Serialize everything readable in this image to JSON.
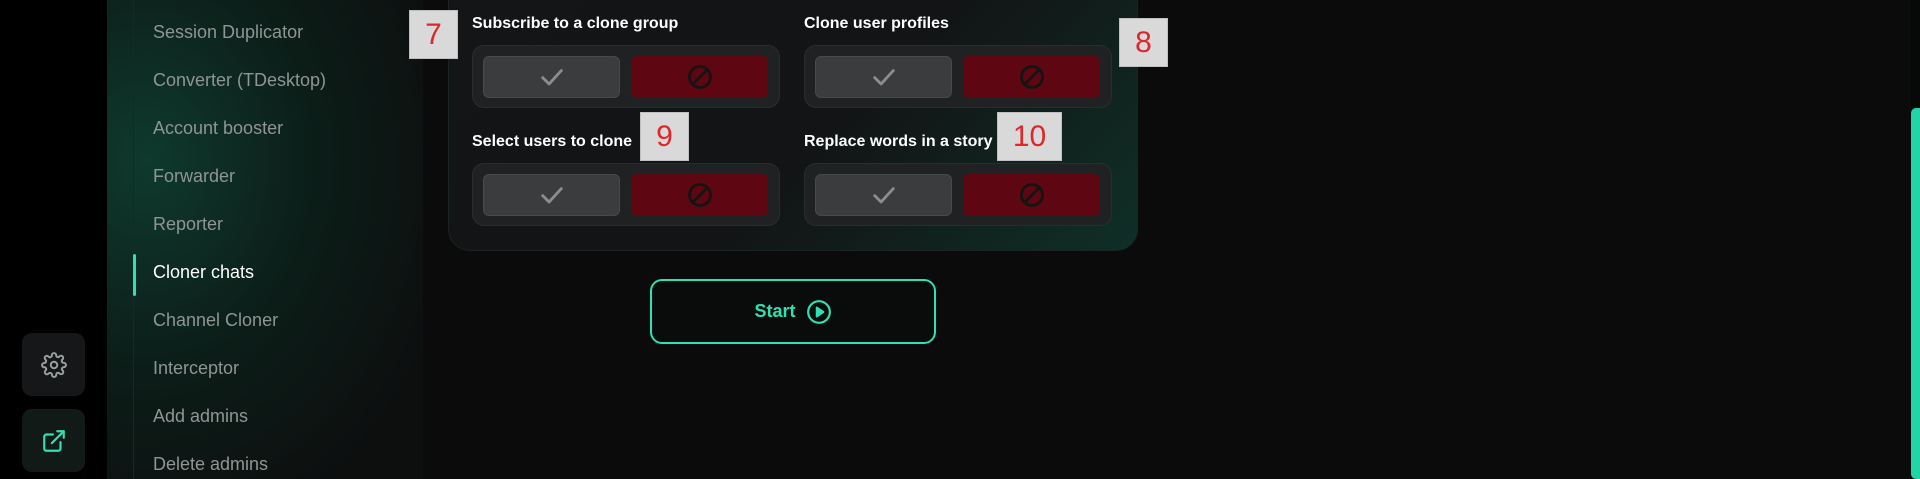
{
  "sidebar": {
    "items": [
      {
        "label": "Session Duplicator"
      },
      {
        "label": "Converter (TDesktop)"
      },
      {
        "label": "Account booster"
      },
      {
        "label": "Forwarder"
      },
      {
        "label": "Reporter"
      },
      {
        "label": "Cloner chats",
        "active": true
      },
      {
        "label": "Channel Cloner"
      },
      {
        "label": "Interceptor"
      },
      {
        "label": "Add admins"
      },
      {
        "label": "Delete admins"
      }
    ]
  },
  "rail": {
    "settings_icon": "gear-icon",
    "open_icon": "external-link-icon"
  },
  "options": [
    {
      "label": "Subscribe to a clone group",
      "yes_icon": "check-icon",
      "no_icon": "ban-icon"
    },
    {
      "label": "Clone user profiles",
      "yes_icon": "check-icon",
      "no_icon": "ban-icon"
    },
    {
      "label": "Select users to clone",
      "yes_icon": "check-icon",
      "no_icon": "ban-icon"
    },
    {
      "label": "Replace words in a story",
      "yes_icon": "check-icon",
      "no_icon": "ban-icon"
    }
  ],
  "badges": [
    "7",
    "8",
    "9",
    "10"
  ],
  "start_button": {
    "label": "Start",
    "icon": "play-circle-icon"
  },
  "colors": {
    "accent": "#2fe0b2",
    "deny": "#5e0612",
    "badge_text": "#e0262a"
  }
}
